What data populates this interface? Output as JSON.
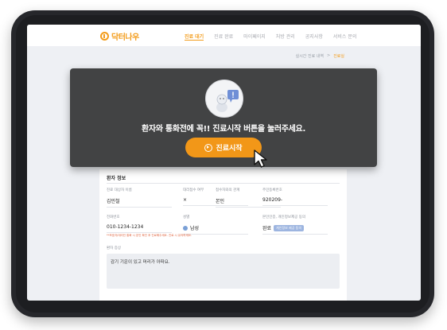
{
  "header": {
    "logo_text": "닥터나우",
    "nav": [
      {
        "label": "진료 대기",
        "active": true
      },
      {
        "label": "진료 완료",
        "active": false
      },
      {
        "label": "마이페이지",
        "active": false
      },
      {
        "label": "처방 관리",
        "active": false
      },
      {
        "label": "공지사항",
        "active": false
      },
      {
        "label": "서비스 문의",
        "active": false
      }
    ]
  },
  "breadcrumb": {
    "parent": "실시간 진료 내역",
    "separator": ">",
    "current": "진료실"
  },
  "overlay": {
    "message": "환자와 통화전에 꼭!! 진료시작 버튼을 눌러주세요.",
    "start_button": "진료시작"
  },
  "patient_panel": {
    "title": "환자 정보",
    "fields": [
      {
        "label": "진료 대상자 이름",
        "value": "김민철"
      },
      {
        "label": "대리접수 여부",
        "value": "×"
      },
      {
        "label": "접수자와의 관계",
        "value": "본인"
      },
      {
        "label": "주민등록번호",
        "value": "920209-"
      },
      {
        "label": "전화번호",
        "value": "010-1234-1234"
      },
      {
        "label": "성별",
        "value": "남성"
      },
      {
        "label": "본인인증, 개인정보제공 동의",
        "value": "완료",
        "tag": "개인정보 제공 동의"
      }
    ],
    "warning": "**보호자/대리인 통화 시 본인 확인 후 진료해주세요. 진료 시 유의하세요.",
    "memo_label": "환자 증상",
    "memo_text": "감기 기운이 있고 머리가 아파요."
  },
  "colors": {
    "accent": "#f29718",
    "overlay": "#424344",
    "screen_bg": "#eef0f4"
  }
}
